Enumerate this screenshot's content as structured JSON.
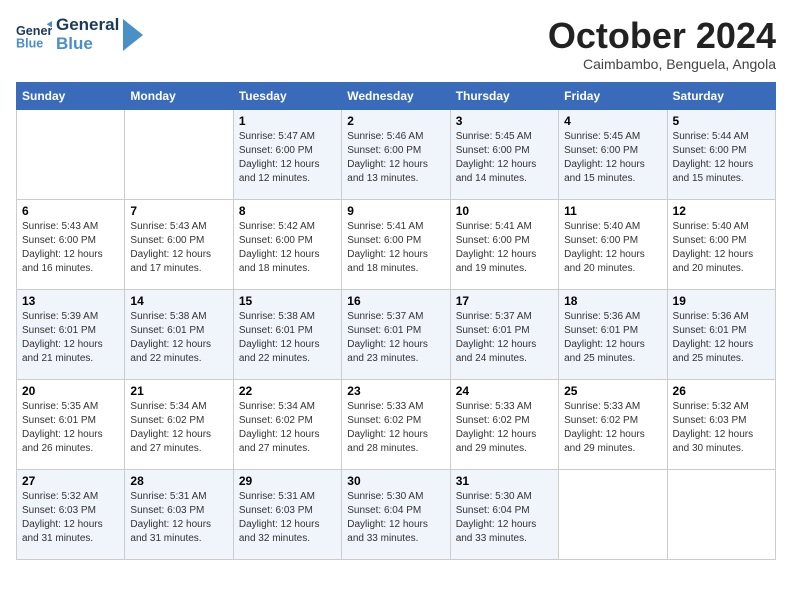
{
  "header": {
    "logo_line1": "General",
    "logo_line2": "Blue",
    "month_title": "October 2024",
    "location": "Caimbambo, Benguela, Angola"
  },
  "weekdays": [
    "Sunday",
    "Monday",
    "Tuesday",
    "Wednesday",
    "Thursday",
    "Friday",
    "Saturday"
  ],
  "weeks": [
    [
      {
        "day": "",
        "info": ""
      },
      {
        "day": "",
        "info": ""
      },
      {
        "day": "1",
        "info": "Sunrise: 5:47 AM\nSunset: 6:00 PM\nDaylight: 12 hours and 12 minutes."
      },
      {
        "day": "2",
        "info": "Sunrise: 5:46 AM\nSunset: 6:00 PM\nDaylight: 12 hours and 13 minutes."
      },
      {
        "day": "3",
        "info": "Sunrise: 5:45 AM\nSunset: 6:00 PM\nDaylight: 12 hours and 14 minutes."
      },
      {
        "day": "4",
        "info": "Sunrise: 5:45 AM\nSunset: 6:00 PM\nDaylight: 12 hours and 15 minutes."
      },
      {
        "day": "5",
        "info": "Sunrise: 5:44 AM\nSunset: 6:00 PM\nDaylight: 12 hours and 15 minutes."
      }
    ],
    [
      {
        "day": "6",
        "info": "Sunrise: 5:43 AM\nSunset: 6:00 PM\nDaylight: 12 hours and 16 minutes."
      },
      {
        "day": "7",
        "info": "Sunrise: 5:43 AM\nSunset: 6:00 PM\nDaylight: 12 hours and 17 minutes."
      },
      {
        "day": "8",
        "info": "Sunrise: 5:42 AM\nSunset: 6:00 PM\nDaylight: 12 hours and 18 minutes."
      },
      {
        "day": "9",
        "info": "Sunrise: 5:41 AM\nSunset: 6:00 PM\nDaylight: 12 hours and 18 minutes."
      },
      {
        "day": "10",
        "info": "Sunrise: 5:41 AM\nSunset: 6:00 PM\nDaylight: 12 hours and 19 minutes."
      },
      {
        "day": "11",
        "info": "Sunrise: 5:40 AM\nSunset: 6:00 PM\nDaylight: 12 hours and 20 minutes."
      },
      {
        "day": "12",
        "info": "Sunrise: 5:40 AM\nSunset: 6:00 PM\nDaylight: 12 hours and 20 minutes."
      }
    ],
    [
      {
        "day": "13",
        "info": "Sunrise: 5:39 AM\nSunset: 6:01 PM\nDaylight: 12 hours and 21 minutes."
      },
      {
        "day": "14",
        "info": "Sunrise: 5:38 AM\nSunset: 6:01 PM\nDaylight: 12 hours and 22 minutes."
      },
      {
        "day": "15",
        "info": "Sunrise: 5:38 AM\nSunset: 6:01 PM\nDaylight: 12 hours and 22 minutes."
      },
      {
        "day": "16",
        "info": "Sunrise: 5:37 AM\nSunset: 6:01 PM\nDaylight: 12 hours and 23 minutes."
      },
      {
        "day": "17",
        "info": "Sunrise: 5:37 AM\nSunset: 6:01 PM\nDaylight: 12 hours and 24 minutes."
      },
      {
        "day": "18",
        "info": "Sunrise: 5:36 AM\nSunset: 6:01 PM\nDaylight: 12 hours and 25 minutes."
      },
      {
        "day": "19",
        "info": "Sunrise: 5:36 AM\nSunset: 6:01 PM\nDaylight: 12 hours and 25 minutes."
      }
    ],
    [
      {
        "day": "20",
        "info": "Sunrise: 5:35 AM\nSunset: 6:01 PM\nDaylight: 12 hours and 26 minutes."
      },
      {
        "day": "21",
        "info": "Sunrise: 5:34 AM\nSunset: 6:02 PM\nDaylight: 12 hours and 27 minutes."
      },
      {
        "day": "22",
        "info": "Sunrise: 5:34 AM\nSunset: 6:02 PM\nDaylight: 12 hours and 27 minutes."
      },
      {
        "day": "23",
        "info": "Sunrise: 5:33 AM\nSunset: 6:02 PM\nDaylight: 12 hours and 28 minutes."
      },
      {
        "day": "24",
        "info": "Sunrise: 5:33 AM\nSunset: 6:02 PM\nDaylight: 12 hours and 29 minutes."
      },
      {
        "day": "25",
        "info": "Sunrise: 5:33 AM\nSunset: 6:02 PM\nDaylight: 12 hours and 29 minutes."
      },
      {
        "day": "26",
        "info": "Sunrise: 5:32 AM\nSunset: 6:03 PM\nDaylight: 12 hours and 30 minutes."
      }
    ],
    [
      {
        "day": "27",
        "info": "Sunrise: 5:32 AM\nSunset: 6:03 PM\nDaylight: 12 hours and 31 minutes."
      },
      {
        "day": "28",
        "info": "Sunrise: 5:31 AM\nSunset: 6:03 PM\nDaylight: 12 hours and 31 minutes."
      },
      {
        "day": "29",
        "info": "Sunrise: 5:31 AM\nSunset: 6:03 PM\nDaylight: 12 hours and 32 minutes."
      },
      {
        "day": "30",
        "info": "Sunrise: 5:30 AM\nSunset: 6:04 PM\nDaylight: 12 hours and 33 minutes."
      },
      {
        "day": "31",
        "info": "Sunrise: 5:30 AM\nSunset: 6:04 PM\nDaylight: 12 hours and 33 minutes."
      },
      {
        "day": "",
        "info": ""
      },
      {
        "day": "",
        "info": ""
      }
    ]
  ]
}
